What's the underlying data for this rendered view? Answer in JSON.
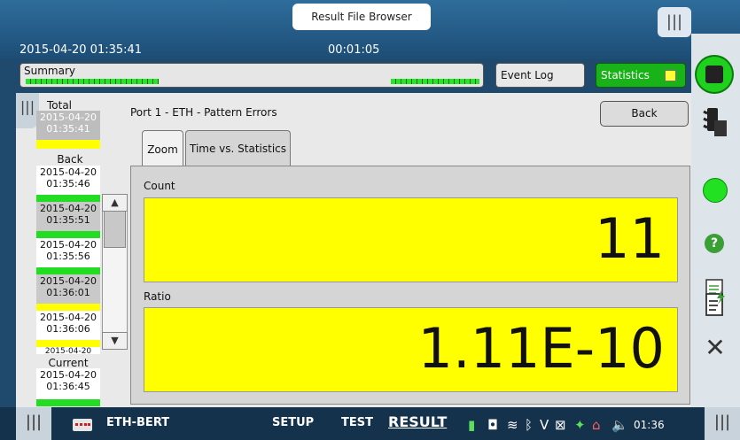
{
  "header": {
    "title": "Result File Browser",
    "datetime": "2015-04-20 01:35:41",
    "elapsed": "00:01:05",
    "grip": "|||"
  },
  "summary": {
    "label": "Summary"
  },
  "buttons": {
    "event_log": "Event Log",
    "statistics": "Statistics",
    "back": "Back"
  },
  "sidebar": {
    "grip": "|||",
    "total_label": "Total",
    "total": {
      "date": "2015-04-20",
      "time": "01:35:41",
      "status_color": "#ffff00"
    },
    "back_label": "Back",
    "items": [
      {
        "date": "2015-04-20",
        "time": "01:35:46",
        "status_color": "#22dd22"
      },
      {
        "date": "2015-04-20",
        "time": "01:35:51",
        "status_color": "#22dd22"
      },
      {
        "date": "2015-04-20",
        "time": "01:35:56",
        "status_color": "#22dd22"
      },
      {
        "date": "2015-04-20",
        "time": "01:36:01",
        "status_color": "#ffff00"
      },
      {
        "date": "2015-04-20",
        "time": "01:36:06",
        "status_color": "#ffff00"
      },
      {
        "date": "2015-04-20",
        "time": ""
      }
    ],
    "current_label": "Current",
    "current": {
      "date": "2015-04-20",
      "time": "01:36:45",
      "status_color": "#22dd22"
    }
  },
  "content": {
    "page_title": "Port 1 - ETH - Pattern Errors",
    "tabs": [
      "Zoom",
      "Time vs. Statistics"
    ],
    "fields": [
      {
        "label": "Count",
        "value": "11"
      },
      {
        "label": "Ratio",
        "value": "1.11E-10"
      }
    ]
  },
  "bottombar": {
    "app_name": "ETH-BERT",
    "setup": "SETUP",
    "test": "TEST",
    "result": "RESULT",
    "time": "01:36",
    "grip": "|||"
  },
  "colors": {
    "accent_green": "#19b219",
    "value_yellow": "#ffff00"
  }
}
